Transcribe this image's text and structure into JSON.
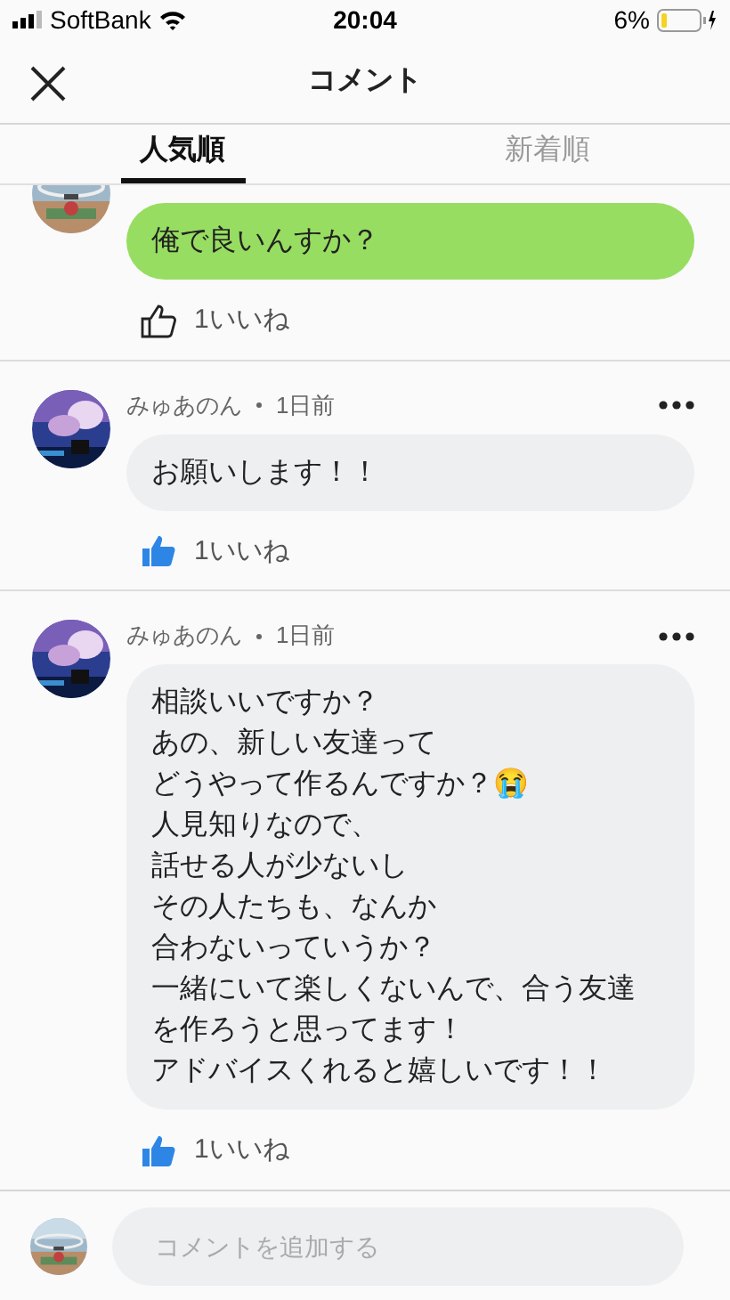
{
  "status_bar": {
    "carrier": "SoftBank",
    "time": "20:04",
    "battery": "6%"
  },
  "header": {
    "title": "コメント"
  },
  "tabs": [
    {
      "label": "人気順",
      "selected": true
    },
    {
      "label": "新着順",
      "selected": false
    }
  ],
  "comments": [
    {
      "kind": "mine",
      "lines": [
        "俺で良いんすか？"
      ],
      "likes": "1いいね",
      "liked": false
    },
    {
      "kind": "other",
      "author": "みゅあのん",
      "time": "1日前",
      "lines": [
        "お願いします！！"
      ],
      "likes": "1いいね",
      "liked": true
    },
    {
      "kind": "other",
      "author": "みゅあのん",
      "time": "1日前",
      "lines": [
        "相談いいですか？",
        "あの、新しい友達って",
        "どうやって作るんですか？😭",
        "人見知りなので、",
        "話せる人が少ないし",
        "その人たちも、なんか",
        "合わないっていうか？",
        "一緒にいて楽しくないんで、合う友達",
        "を作ろうと思ってます！",
        "アドバイスくれると嬉しいです！！"
      ],
      "likes": "1いいね",
      "liked": true
    }
  ],
  "composer": {
    "placeholder": "コメントを追加する"
  }
}
